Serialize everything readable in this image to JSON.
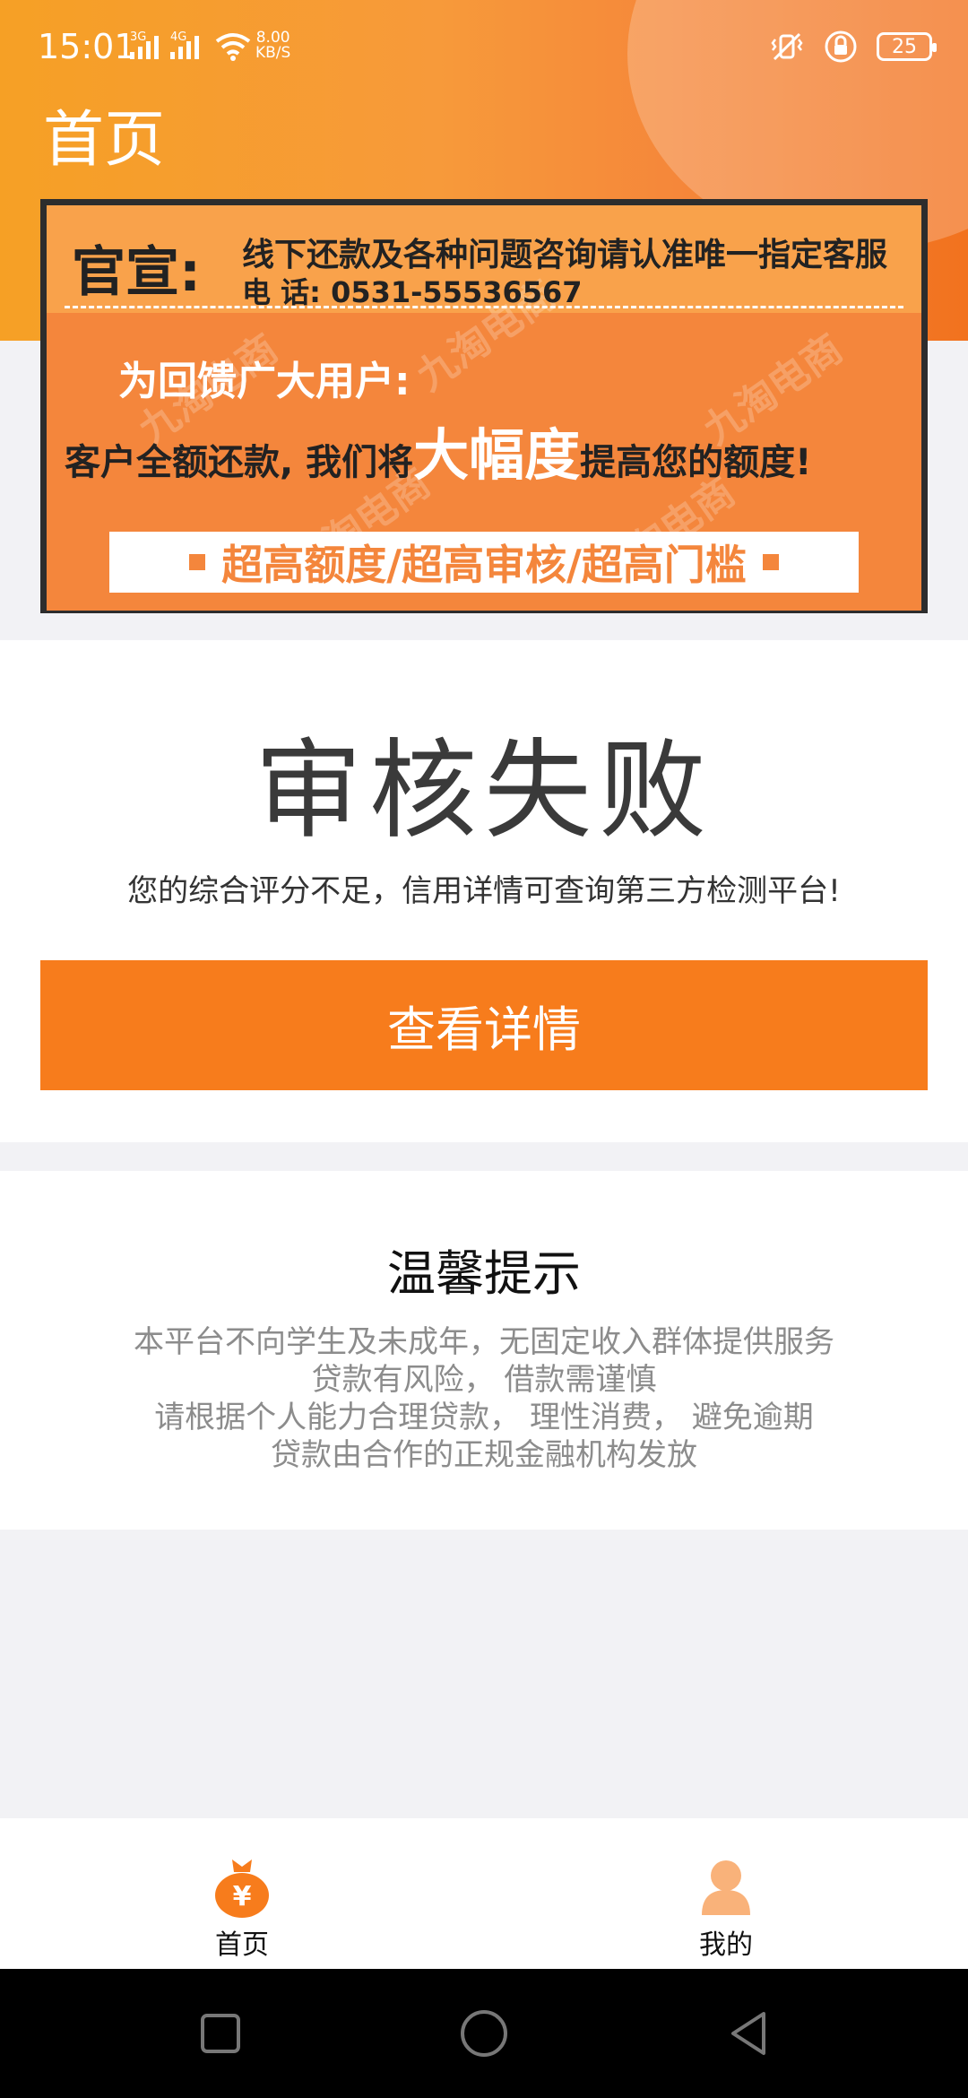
{
  "status_bar": {
    "time": "15:01",
    "sim1_label": "3G",
    "sim2_label": "4G",
    "net_speed_value": "8.00",
    "net_speed_unit": "KB/S",
    "battery": "25"
  },
  "header": {
    "title": "首页"
  },
  "banner": {
    "official_label": "官宣:",
    "line1": "线下还款及各种问题咨询请认准唯一指定客服",
    "line2": "电 话: 0531-55536567",
    "heading": "为回馈广大用户:",
    "main_prefix": "客户全额还款, 我们将",
    "main_big": "大幅度",
    "main_mid": "提高您的",
    "main_end": "额度!",
    "strip": "超高额度/超高审核/超高门槛",
    "watermark": "九淘电商"
  },
  "result": {
    "title": "审核失败",
    "description": "您的综合评分不足，信用详情可查询第三方检测平台!",
    "button_label": "查看详情"
  },
  "tips": {
    "title": "温馨提示",
    "lines": [
      "本平台不向学生及未成年，无固定收入群体提供服务",
      "贷款有风险， 借款需谨慎",
      "请根据个人能力合理贷款， 理性消费， 避免逾期",
      "贷款由合作的正规金融机构发放"
    ]
  },
  "tab_bar": {
    "items": [
      {
        "label": "首页",
        "icon": "money-bag-icon",
        "color": "#f77c1c"
      },
      {
        "label": "我的",
        "icon": "user-icon",
        "color": "#f9b27a"
      }
    ]
  },
  "colors": {
    "accent": "#f77c1c",
    "header_gradient_start": "#f6a025",
    "header_gradient_end": "#f2721e"
  }
}
